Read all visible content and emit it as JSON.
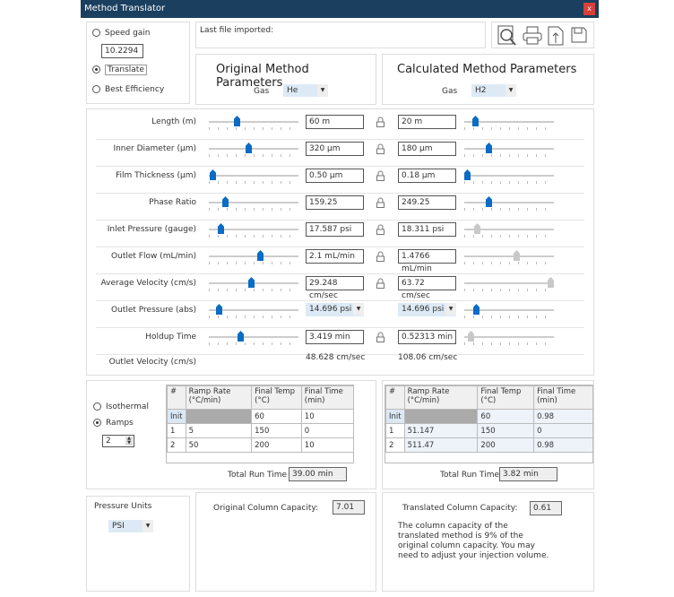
{
  "window": {
    "title": "Method Translator",
    "close": "x"
  },
  "mode": {
    "speed_gain_label": "Speed gain",
    "speed_gain_value": "10.2294",
    "translate_label": "Translate",
    "best_efficiency_label": "Best Efficiency",
    "selected": "Translate"
  },
  "file": {
    "last_imported_label": "Last file imported:"
  },
  "toolbar": {
    "icons": [
      "search-icon",
      "print-icon",
      "export-icon",
      "save-icon"
    ]
  },
  "original": {
    "title": "Original Method Parameters",
    "gas_label": "Gas",
    "gas": "He"
  },
  "calculated": {
    "title": "Calculated Method Parameters",
    "gas_label": "Gas",
    "gas": "H2"
  },
  "params": [
    {
      "label": "Length (m)",
      "orig": "60 m",
      "calc": "20 m",
      "orig_pos": 0.31,
      "calc_pos": 0.12,
      "calc_enabled": true
    },
    {
      "label": "Inner Diameter (µm)",
      "orig": "320 µm",
      "calc": "180 µm",
      "orig_pos": 0.44,
      "calc_pos": 0.27,
      "calc_enabled": true
    },
    {
      "label": "Film Thickness (µm)",
      "orig": "0.50 µm",
      "calc": "0.18 µm",
      "orig_pos": 0.04,
      "calc_pos": 0.03,
      "calc_enabled": true
    },
    {
      "label": "Phase Ratio",
      "orig": "159.25",
      "calc": "249.25",
      "orig_pos": 0.18,
      "calc_pos": 0.27,
      "calc_enabled": true
    },
    {
      "label": "Inlet Pressure (gauge)",
      "orig": "17.587 psi",
      "calc": "18.311 psi",
      "orig_pos": 0.13,
      "calc_pos": 0.14,
      "calc_enabled": false
    },
    {
      "label": "Outlet Flow (mL/min)",
      "orig": "2.1 mL/min",
      "calc": "1.4766 mL/min",
      "orig_pos": 0.57,
      "calc_pos": 0.58,
      "calc_enabled": false
    },
    {
      "label": "Average Velocity (cm/s)",
      "orig": "29.248 cm/sec",
      "calc": "63.72 cm/sec",
      "orig_pos": 0.47,
      "calc_pos": 0.96,
      "calc_enabled": false
    },
    {
      "label": "Outlet Pressure (abs)",
      "orig": "14.696 psi",
      "calc": "14.696 psi",
      "orig_pos": 0.11,
      "calc_pos": 0.13,
      "calc_enabled": true,
      "combo": true
    },
    {
      "label": "Holdup Time",
      "orig": "3.419 min",
      "calc": "0.52313 min",
      "orig_pos": 0.35,
      "calc_pos": 0.07,
      "calc_enabled": false
    }
  ],
  "outlet_velocity": {
    "label": "Outlet Velocity (cm/s)",
    "orig": "48.628 cm/sec",
    "calc": "108.06 cm/sec"
  },
  "oven": {
    "isothermal_label": "Isothermal",
    "ramps_label": "Ramps",
    "selected": "Ramps",
    "ramp_count": "2"
  },
  "table_headers": [
    "#",
    "Ramp Rate (°C/min)",
    "Final Temp (°C)",
    "Final Time (min)"
  ],
  "orig_table": [
    [
      "Init",
      "",
      "60",
      "10"
    ],
    [
      "1",
      "5",
      "150",
      "0"
    ],
    [
      "2",
      "50",
      "200",
      "10"
    ]
  ],
  "calc_table": [
    [
      "Init",
      "",
      "60",
      "0.98"
    ],
    [
      "1",
      "51.147",
      "150",
      "0"
    ],
    [
      "2",
      "511.47",
      "200",
      "0.98"
    ]
  ],
  "orig_run": {
    "label": "Total Run Time",
    "value": "39.00 min"
  },
  "calc_run": {
    "label": "Total Run Time",
    "value": "3.82 min"
  },
  "pressure": {
    "label": "Pressure Units",
    "value": "PSI"
  },
  "capacity": {
    "orig_label": "Original Column Capacity:",
    "orig_value": "7.01",
    "calc_label": "Translated Column Capacity:",
    "calc_value": "0.61",
    "note": "The column capacity of the translated method is 9% of the original column capacity.  You may need to adjust your injection volume."
  }
}
